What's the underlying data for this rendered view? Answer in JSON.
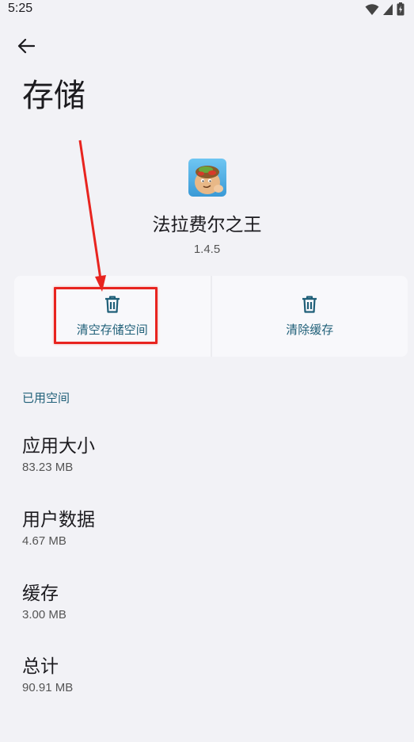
{
  "status_bar": {
    "time": "5:25"
  },
  "page": {
    "title": "存储"
  },
  "app": {
    "name": "法拉费尔之王",
    "version": "1.4.5",
    "icon": "app-icon-falafel-king"
  },
  "actions": {
    "clear_storage_label": "清空存储空间",
    "clear_cache_label": "清除缓存",
    "icon": "trash-icon",
    "accent_color": "#1f5f78"
  },
  "annotation": {
    "color": "#e8241f",
    "target": "clear-storage-button"
  },
  "usage": {
    "section_title": "已用空间",
    "items": [
      {
        "label": "应用大小",
        "value": "83.23 MB"
      },
      {
        "label": "用户数据",
        "value": "4.67 MB"
      },
      {
        "label": "缓存",
        "value": "3.00 MB"
      },
      {
        "label": "总计",
        "value": "90.91 MB"
      }
    ]
  }
}
